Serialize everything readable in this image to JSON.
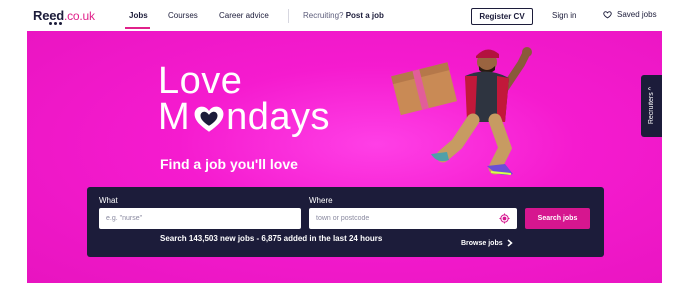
{
  "nav": {
    "logo_main": "Reed",
    "logo_tld": ".co.uk",
    "links": {
      "jobs": "Jobs",
      "courses": "Courses",
      "career_advice": "Career advice"
    },
    "recruiting_prefix": "Recruiting?",
    "post_job": "Post a job",
    "register_cv": "Register CV",
    "sign_in": "Sign in",
    "saved_jobs": "Saved jobs"
  },
  "hero": {
    "headline_line1": "Love",
    "headline_line2_a": "M",
    "headline_line2_b": "ndays",
    "tagline": "Find a job you'll love",
    "recruiters_tab": "Recruiters ^"
  },
  "search": {
    "what_label": "What",
    "what_placeholder": "e.g. \"nurse\"",
    "what_value": "",
    "where_label": "Where",
    "where_placeholder": "town or postcode",
    "where_value": "",
    "search_button": "Search jobs",
    "browse_jobs": "Browse jobs",
    "stats": "Search 143,503 new jobs - 6,875 added in the last 24 hours"
  },
  "colors": {
    "brand_navy": "#1c1c3a",
    "brand_pink": "#e0218a",
    "hero_magenta": "#f51bcf",
    "search_button": "#d6168f"
  },
  "icons": {
    "saved": "heart-outline-icon",
    "location": "location-target-icon",
    "browse": "chevron-right-icon"
  }
}
